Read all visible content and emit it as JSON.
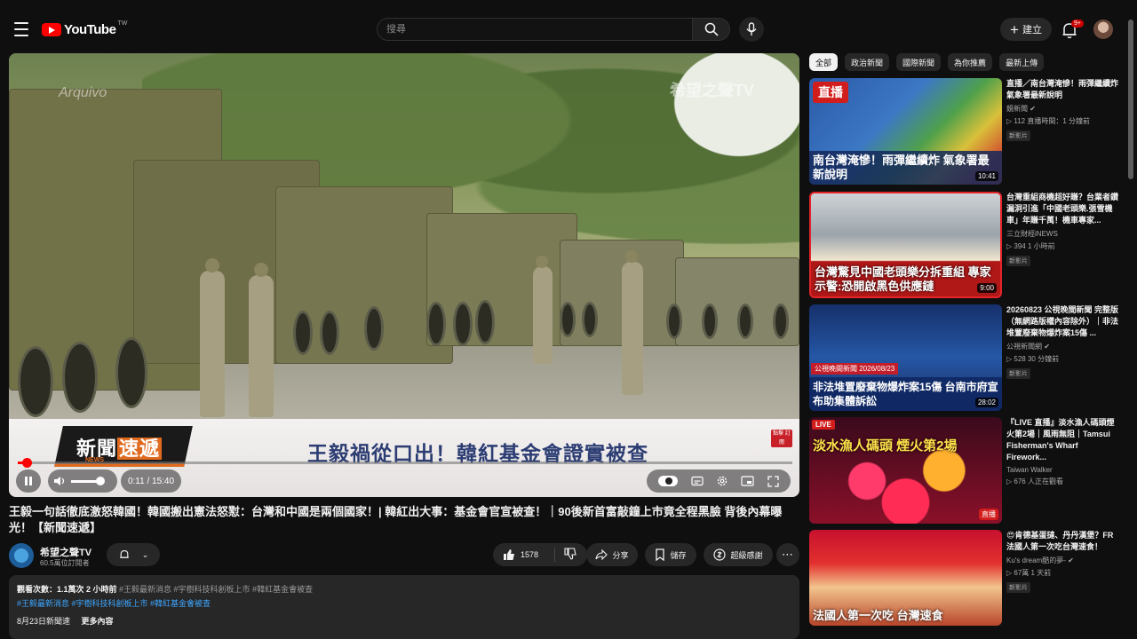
{
  "header": {
    "logo_text": "YouTube",
    "logo_region": "TW",
    "search_placeholder": "搜尋",
    "create_label": "建立",
    "notification_count": "9+"
  },
  "player": {
    "news_brand": "新聞",
    "news_brand_hl": "速遞",
    "news_brand_sub": "NEWS",
    "lower_third_headline": "王毅禍從口出！韓紅基金會證實被查",
    "subscribe_badge": "點擊 訂閱",
    "watermark_left": "Arquivo",
    "watermark_right": "希望之聲TV",
    "time_display": "0:11 / 15:40",
    "progress_fraction": 0.012
  },
  "video": {
    "title": "王毅一句話徹底激怒韓國！韓國搬出憲法怒懟：台灣和中國是兩個國家！| 韓紅出大事：基金會官宣被查！｜90後新首富敲鐘上市竟全程黑臉 背後內幕曝光！【新聞速遞】",
    "channel_name": "希望之聲TV",
    "subscribers": "60.5萬位訂閱者",
    "likes": "1578",
    "share_label": "分享",
    "save_label": "儲存",
    "thanks_label": "超級感謝"
  },
  "description": {
    "views": "觀看次數：1.1萬次  2 小時前",
    "tags_line1": "#王毅最新消息 #宇樹科技科創板上市 #韓紅基金會被查",
    "tags_line2": "#王毅最新消息 #宇樹科技科創板上市 #韓紅基金會被查",
    "line3_a": "8月23日新聞速",
    "line3_b": "更多內容"
  },
  "chips": [
    "全部",
    "政治新聞",
    "國際新聞",
    "為你推薦",
    "最新上傳"
  ],
  "recommendations": [
    {
      "thumb_caption": "南台灣淹慘！雨彈繼續炸 氣象署最新說明",
      "thumb_badge": "直播",
      "duration": "10:41",
      "title": "直播／南台灣淹慘！雨彈繼續炸　氣象署最新說明",
      "channel": "鏡新聞",
      "meta": "▷ 112  直播時間：1 分鐘前",
      "badge": "新影片"
    },
    {
      "thumb_caption": "台灣驚見中國老頭樂分拆重組 專家示警:恐開啟黑色供應鏈",
      "thumb_badge": "",
      "duration": "9:00",
      "title": "台灣重組商機超好賺？台業者鑽漏洞引進「中國老頭樂.張雪機車」年賺千萬！機車專家...",
      "channel": "三立財經iNEWS",
      "meta": "▷ 394  1 小時前",
      "badge": "新影片"
    },
    {
      "thumb_caption": "非法堆置廢棄物爆炸案15傷 台南市府宣布助集體訴訟",
      "thumb_badge": "公視晚間新聞 2026/08/23",
      "duration": "28:02",
      "title": "20260823 公視晚間新聞 完整版（無網路版權內容除外）｜非法堆置廢棄物爆炸案15傷 ...",
      "channel": "公視新聞網",
      "meta": "▷ 528  30 分鐘前",
      "badge": "新影片"
    },
    {
      "thumb_caption": "淡水漁人碼頭 煙火第2場",
      "thumb_badge": "LIVE",
      "duration": "直播",
      "title": "『LIVE 直播』淡水漁人碼頭煙火第2場｜風雨無阻｜Tamsui Fisherman's Wharf Firework...",
      "channel": "Taiwan Walker",
      "meta": "▷ 676 人正在觀看",
      "badge": ""
    },
    {
      "thumb_caption": "法國人第一次吃 台灣速食",
      "thumb_badge": "",
      "duration": "",
      "title": "😍肯德基蛋撻、丹丹漢堡？FR 法國人第一次吃台灣速食！",
      "channel": "Ku's dream酷的夢-",
      "meta": "▷ 67萬  1 天前",
      "badge": "新影片"
    }
  ]
}
